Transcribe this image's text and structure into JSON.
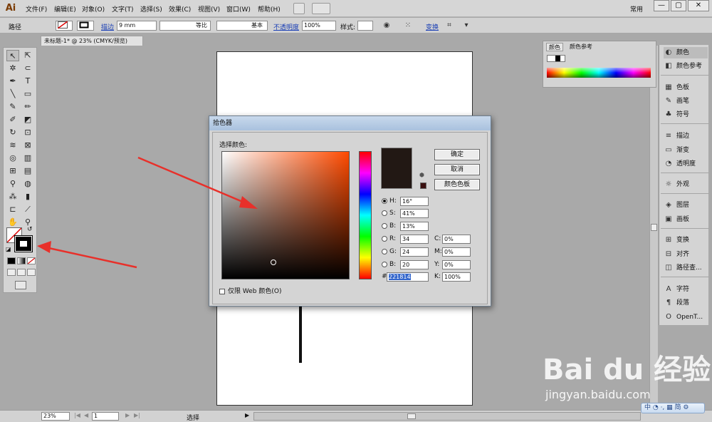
{
  "app": {
    "logo": "Ai",
    "workspace": "常用"
  },
  "menu": [
    "文件(F)",
    "编辑(E)",
    "对象(O)",
    "文字(T)",
    "选择(S)",
    "效果(C)",
    "视图(V)",
    "窗口(W)",
    "帮助(H)"
  ],
  "window_controls": {
    "minimize": "—",
    "restore": "▢",
    "close": "✕"
  },
  "controlbar": {
    "object_type": "路径",
    "stroke_label": "描边",
    "stroke_weight": "9 mm",
    "profile_label": "等比",
    "brush_label": "基本",
    "opacity_label": "不透明度",
    "opacity_value": "100%",
    "style_label": "样式:",
    "transform_label": "变换"
  },
  "document": {
    "tab": "未标题-1* @ 23% (CMYK/预览)"
  },
  "color_panel": {
    "tab_color": "颜色",
    "tab_guide": "颜色参考"
  },
  "dock": {
    "items": [
      {
        "label": "颜色",
        "icon": "◐"
      },
      {
        "label": "颜色参考",
        "icon": "◧"
      },
      {
        "label": "色板",
        "icon": "▦"
      },
      {
        "label": "画笔",
        "icon": "✎"
      },
      {
        "label": "符号",
        "icon": "♣"
      },
      {
        "label": "描边",
        "icon": "≡"
      },
      {
        "label": "渐变",
        "icon": "▭"
      },
      {
        "label": "透明度",
        "icon": "◔"
      },
      {
        "label": "外观",
        "icon": "☼"
      },
      {
        "label": "图层",
        "icon": "◈"
      },
      {
        "label": "画板",
        "icon": "▣"
      },
      {
        "label": "变换",
        "icon": "⊞"
      },
      {
        "label": "对齐",
        "icon": "⊟"
      },
      {
        "label": "路径查...",
        "icon": "◫"
      },
      {
        "label": "字符",
        "icon": "A"
      },
      {
        "label": "段落",
        "icon": "¶"
      },
      {
        "label": "OpenT...",
        "icon": "O"
      }
    ]
  },
  "picker": {
    "title": "拾色器",
    "select_label": "选择颜色:",
    "color_hex": "#221814",
    "buttons": {
      "ok": "确定",
      "cancel": "取消",
      "swatches": "颜色色板"
    },
    "hsb": [
      {
        "label": "H:",
        "value": "16°",
        "selected": true
      },
      {
        "label": "S:",
        "value": "41%",
        "selected": false
      },
      {
        "label": "B:",
        "value": "13%",
        "selected": false
      }
    ],
    "rgb": [
      {
        "label": "R:",
        "value": "34"
      },
      {
        "label": "G:",
        "value": "24"
      },
      {
        "label": "B:",
        "value": "20"
      }
    ],
    "cmyk": [
      {
        "label": "C:",
        "value": "0%"
      },
      {
        "label": "M:",
        "value": "0%"
      },
      {
        "label": "Y:",
        "value": "0%"
      },
      {
        "label": "K:",
        "value": "100%"
      }
    ],
    "hex_label": "#",
    "hex_value": "221814",
    "web_only_label": "仅限 Web 颜色(O)"
  },
  "statusbar": {
    "zoom": "23%",
    "page": "1",
    "tool": "选择"
  },
  "watermark": {
    "logo": "Bai du 经验",
    "url": "jingyan.baidu.com"
  },
  "ime": {
    "text": "中 ◔ ·, ▦ 简 ⚙"
  }
}
